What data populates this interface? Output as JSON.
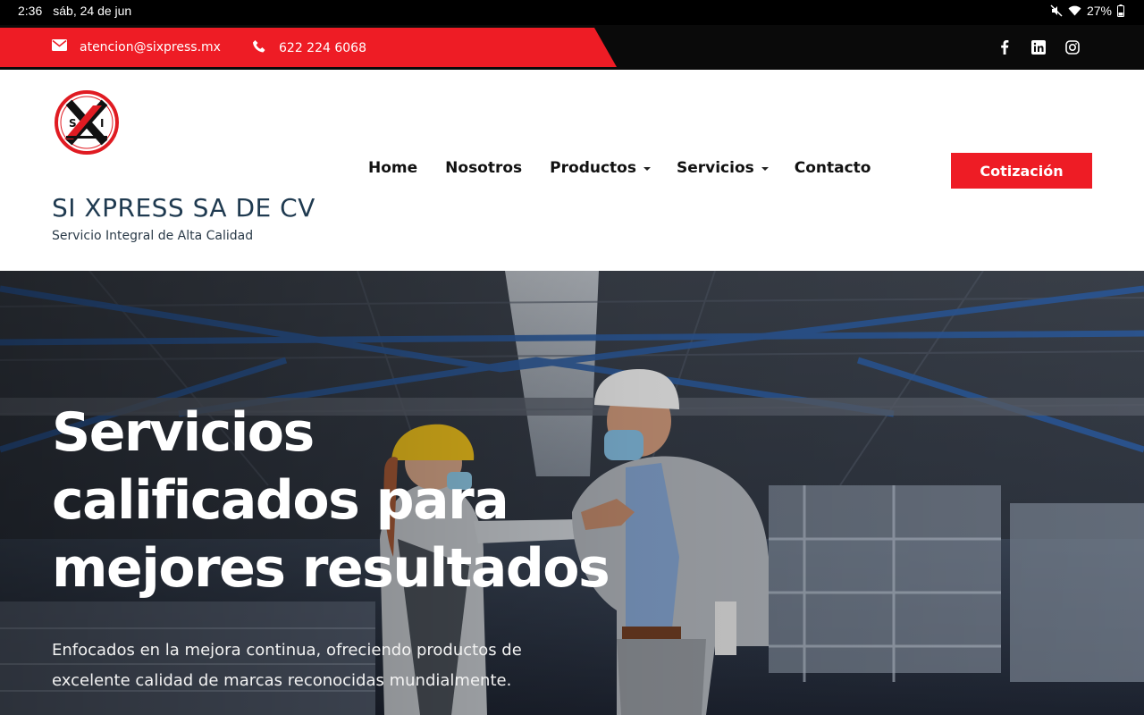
{
  "status_bar": {
    "time": "2:36",
    "date": "sáb, 24 de jun",
    "battery": "27%",
    "icons": [
      "mute-icon",
      "wifi-icon",
      "battery-icon"
    ]
  },
  "topbar": {
    "email": "atencion@sixpress.mx",
    "phone": "622 224 6068",
    "social": [
      "facebook-icon",
      "linkedin-icon",
      "instagram-icon"
    ]
  },
  "header": {
    "brand_name": "SI XPRESS SA DE CV",
    "tagline": "Servicio Integral de Alta Calidad",
    "logo_letters": [
      "S",
      "X",
      "I"
    ],
    "nav": [
      {
        "label": "Home",
        "dropdown": false
      },
      {
        "label": "Nosotros",
        "dropdown": false
      },
      {
        "label": "Productos",
        "dropdown": true
      },
      {
        "label": "Servicios",
        "dropdown": true
      },
      {
        "label": "Contacto",
        "dropdown": false
      }
    ],
    "cta_label": "Cotización"
  },
  "hero": {
    "title_lines": [
      "Servicios",
      "calificados para",
      "mejores resultados"
    ],
    "subtitle_lines": [
      "Enfocados en la mejora continua, ofreciendo productos de",
      "excelente calidad de marcas reconocidas mundialmente."
    ]
  },
  "colors": {
    "accent_red": "#ee1c25",
    "topbar_black": "#0a0a0a",
    "brand_blue": "#1f3a50"
  }
}
